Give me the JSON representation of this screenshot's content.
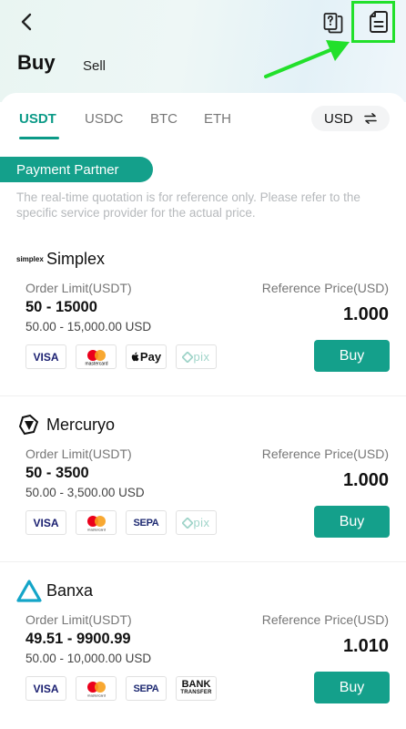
{
  "header": {
    "mode_buy": "Buy",
    "mode_sell": "Sell"
  },
  "tabs": [
    {
      "label": "USDT",
      "active": true
    },
    {
      "label": "USDC",
      "active": false
    },
    {
      "label": "BTC",
      "active": false
    },
    {
      "label": "ETH",
      "active": false
    }
  ],
  "currency": {
    "label": "USD"
  },
  "section": {
    "tag": "Payment Partner",
    "disclaimer": "The real-time quotation is for reference only. Please refer to the specific service provider for the actual price."
  },
  "providers": [
    {
      "name": "Simplex",
      "logo_text": "simplex",
      "limit_label": "Order Limit(USDT)",
      "ref_label": "Reference Price(USD)",
      "range": "50  -  15000",
      "range_sub": "50.00 - 15,000.00 USD",
      "price": "1.000",
      "buy_label": "Buy",
      "methods": [
        "VISA",
        "mastercard",
        "Pay",
        "pix"
      ]
    },
    {
      "name": "Mercuryo",
      "limit_label": "Order Limit(USDT)",
      "ref_label": "Reference Price(USD)",
      "range": "50  -  3500",
      "range_sub": "50.00 - 3,500.00 USD",
      "price": "1.000",
      "buy_label": "Buy",
      "methods": [
        "VISA",
        "mastercard",
        "SEPA",
        "pix"
      ]
    },
    {
      "name": "Banxa",
      "limit_label": "Order Limit(USDT)",
      "ref_label": "Reference Price(USD)",
      "range": "49.51  -  9900.99",
      "range_sub": "50.00 - 10,000.00 USD",
      "price": "1.010",
      "buy_label": "Buy",
      "methods": [
        "VISA",
        "mastercard",
        "SEPA",
        "BANK",
        "TRANSFER"
      ]
    }
  ],
  "colors": {
    "accent": "#14a08b",
    "highlight": "#22e02b"
  },
  "icons": [
    "back-icon",
    "help-icon",
    "orders-icon",
    "swap-icon"
  ]
}
